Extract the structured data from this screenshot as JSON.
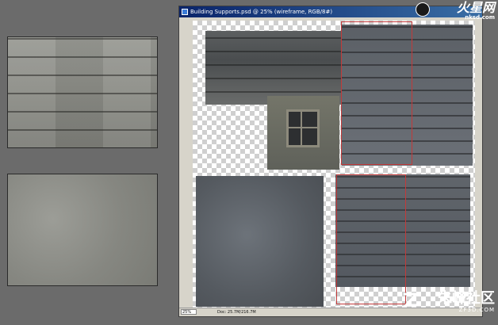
{
  "swatches": [
    "brick-wall-texture",
    "concrete-texture"
  ],
  "window": {
    "title": "Building Supports.psd @ 25% (wireframe, RGB/8#)",
    "icon": "photoshop-doc-icon"
  },
  "canvas": {
    "textures": [
      "wall-top-left",
      "window-panel",
      "wall-top-right",
      "wall-bottom-left",
      "wall-bottom-right"
    ],
    "selection_color": "#c23a3a"
  },
  "status": {
    "zoom": "25%",
    "doc": "Doc: 25.7M/216.7M"
  },
  "watermarks": {
    "top_brand": "火星网",
    "top_url": "nksd.com",
    "bottom_brand": "朱峰社区",
    "bottom_url": "ZF3D.COM"
  }
}
